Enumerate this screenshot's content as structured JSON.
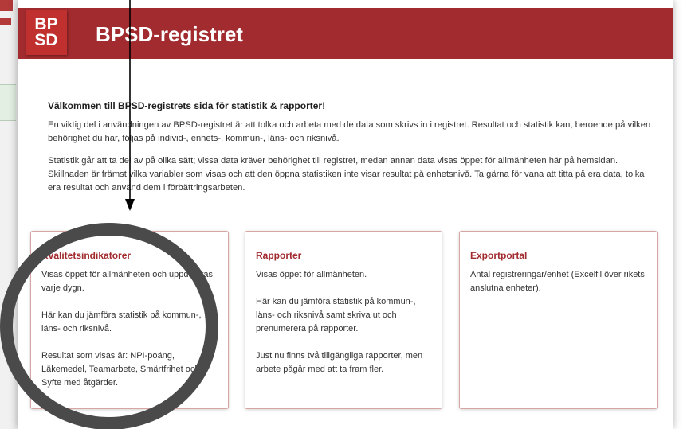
{
  "logo": {
    "line1": "BP",
    "line2": "SD"
  },
  "header": {
    "title": "BPSD-registret"
  },
  "intro": {
    "heading": "Välkommen till BPSD-registrets sida för statistik & rapporter!",
    "paragraph1": "En viktig del i användningen av BPSD-registret är att tolka och arbeta med de data som skrivs in i registret. Resultat och statistik kan, beroende på vilken behörighet du har, följas på individ-, enhets-, kommun-, läns- och riksnivå.",
    "paragraph2": "Statistik går att ta del av på olika sätt; vissa data kräver behörighet till registret, medan annan data visas öppet för allmänheten här på hemsidan. Skillnaden är främst vilka variabler som visas och att den öppna statistiken inte visar resultat på enhetsnivå. Ta gärna för vana att titta på era data, tolka era resultat och använd dem i förbättringsarbeten."
  },
  "cards": [
    {
      "title": "Kvalitetsindikatorer",
      "paragraphs": [
        "Visas öppet för allmänheten och uppdateras varje dygn.",
        "Här kan du jämföra statistik på kommun-, läns- och riksnivå.",
        "Resultat som visas är: NPI-poäng, Läkemedel, Teamarbete, Smärtfrihet och Syfte med åtgärder."
      ]
    },
    {
      "title": "Rapporter",
      "paragraphs": [
        "Visas öppet för allmänheten.",
        "Här kan du jämföra statistik på kommun-, läns- och riksnivå samt skriva ut och prenumerera på rapporter.",
        "Just nu finns två tillgängliga rapporter, men arbete pågår med att ta fram fler."
      ]
    },
    {
      "title": "Exportportal",
      "paragraphs": [
        "Antal registreringar/enhet (Excelfil över rikets anslutna enheter)."
      ]
    }
  ],
  "colors": {
    "brand_red": "#a12b2e",
    "card_border": "#d8a5a5",
    "annotation_circle": "#4a4a4a"
  }
}
